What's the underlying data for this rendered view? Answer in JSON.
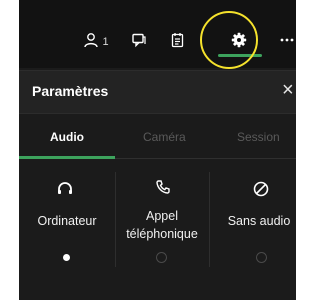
{
  "toolbar": {
    "participants_count": "1"
  },
  "panel": {
    "title": "Paramètres",
    "close_label": "×"
  },
  "tabs": [
    {
      "label": "Audio",
      "active": true
    },
    {
      "label": "Caméra",
      "active": false
    },
    {
      "label": "Session",
      "active": false
    }
  ],
  "audio_options": [
    {
      "label": "Ordinateur",
      "icon": "headset-icon",
      "selected": true
    },
    {
      "label_line1": "Appel",
      "label_line2": "téléphonique",
      "icon": "phone-icon",
      "selected": false
    },
    {
      "label": "Sans audio",
      "icon": "no-audio-icon",
      "selected": false
    }
  ],
  "colors": {
    "accent": "#3da35d",
    "highlight": "#f5e22c",
    "panel_bg": "#1b1b1b"
  }
}
